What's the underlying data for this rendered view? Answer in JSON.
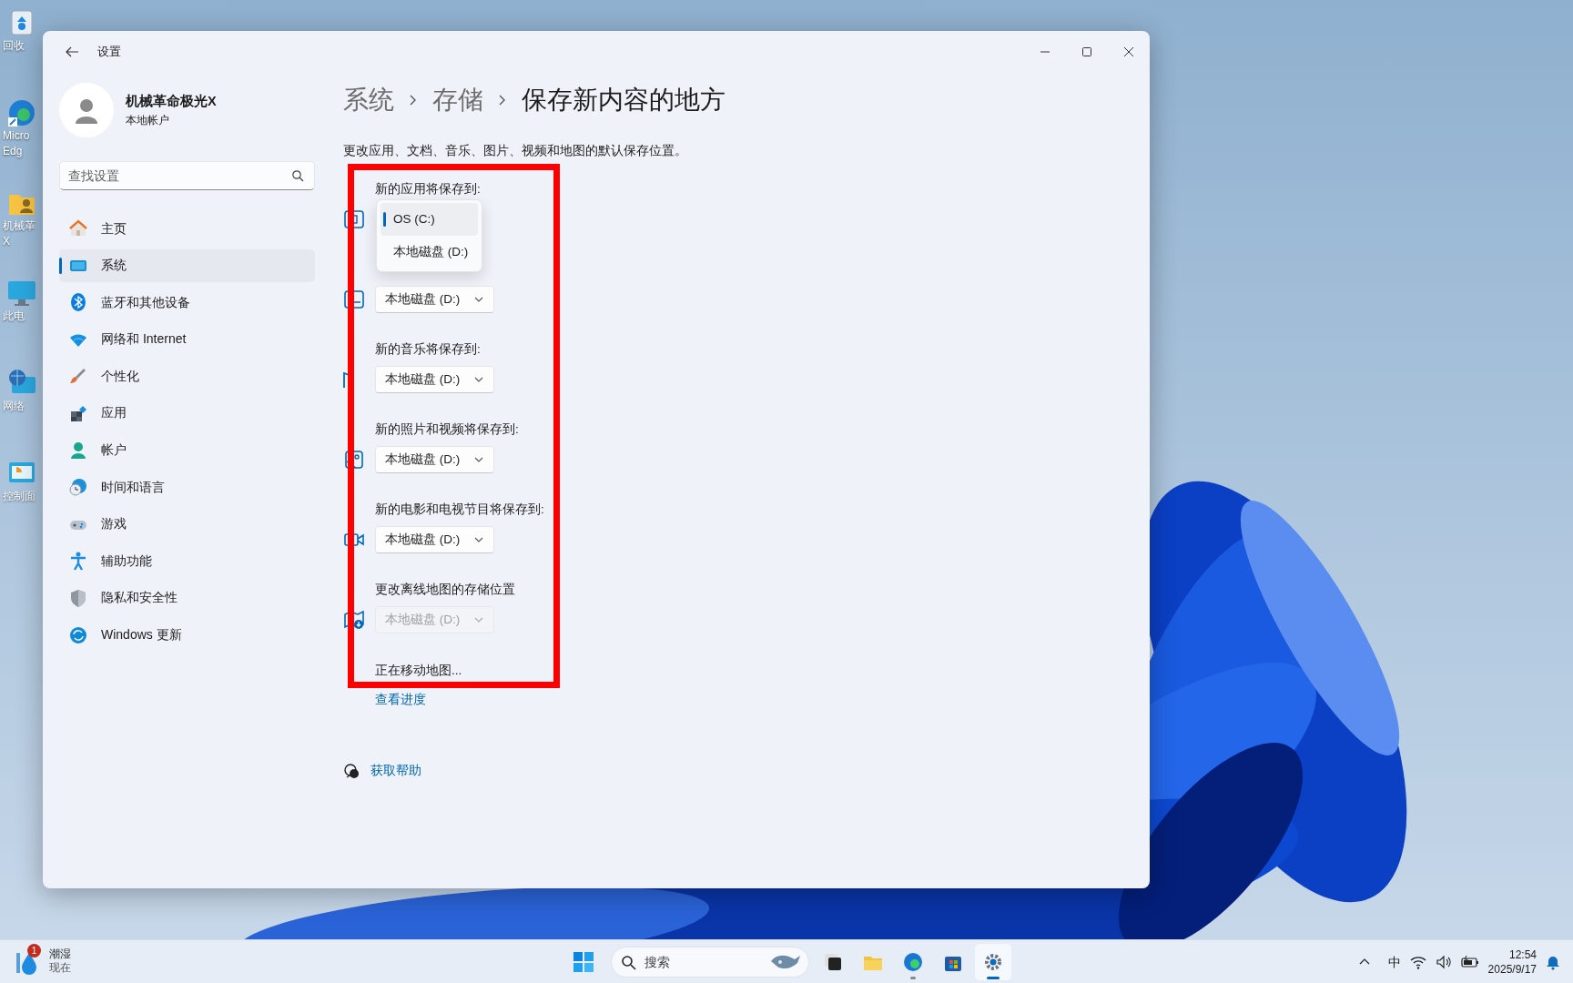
{
  "desktop": {
    "icons": [
      {
        "lines": [
          "回收"
        ]
      },
      {
        "lines": [
          "Micro",
          "Edg"
        ]
      },
      {
        "lines": [
          "机械革",
          "X"
        ]
      },
      {
        "lines": [
          "此电"
        ]
      },
      {
        "lines": [
          "网络"
        ]
      },
      {
        "lines": [
          "控制面"
        ]
      }
    ]
  },
  "window": {
    "title": "设置",
    "profile": {
      "name": "机械革命极光X",
      "account_type": "本地帐户"
    },
    "search": {
      "placeholder": "查找设置"
    },
    "sidebar": {
      "items": [
        {
          "label": "主页",
          "selected": false
        },
        {
          "label": "系统",
          "selected": true
        },
        {
          "label": "蓝牙和其他设备",
          "selected": false
        },
        {
          "label": "网络和 Internet",
          "selected": false
        },
        {
          "label": "个性化",
          "selected": false
        },
        {
          "label": "应用",
          "selected": false
        },
        {
          "label": "帐户",
          "selected": false
        },
        {
          "label": "时间和语言",
          "selected": false
        },
        {
          "label": "游戏",
          "selected": false
        },
        {
          "label": "辅助功能",
          "selected": false
        },
        {
          "label": "隐私和安全性",
          "selected": false
        },
        {
          "label": "Windows 更新",
          "selected": false
        }
      ]
    },
    "breadcrumb": [
      {
        "label": "系统",
        "current": false
      },
      {
        "label": "存储",
        "current": false
      },
      {
        "label": "保存新内容的地方",
        "current": true
      }
    ],
    "description": "更改应用、文档、音乐、图片、视频和地图的默认保存位置。",
    "settings": [
      {
        "label": "新的应用将保存到:",
        "expanded": true,
        "disabled": false,
        "options": [
          {
            "label": "OS (C:)",
            "selected": true
          },
          {
            "label": "本地磁盘 (D:)",
            "selected": false
          }
        ]
      },
      {
        "value": "本地磁盘 (D:)",
        "expanded": false,
        "disabled": false
      },
      {
        "label": "新的音乐将保存到:",
        "value": "本地磁盘 (D:)",
        "expanded": false,
        "disabled": false
      },
      {
        "label": "新的照片和视频将保存到:",
        "value": "本地磁盘 (D:)",
        "expanded": false,
        "disabled": false
      },
      {
        "label": "新的电影和电视节目将保存到:",
        "value": "本地磁盘 (D:)",
        "expanded": false,
        "disabled": false
      },
      {
        "label": "更改离线地图的存储位置",
        "value": "本地磁盘 (D:)",
        "expanded": false,
        "disabled": true
      }
    ],
    "status": "正在移动地图...",
    "progress_link": "查看进度",
    "help_link": "获取帮助"
  },
  "annotation_frame": true,
  "taskbar": {
    "weather": {
      "condition": "潮湿",
      "time": "现在",
      "badge": "1"
    },
    "search": {
      "placeholder": "搜索"
    },
    "apps": [
      {
        "selected": false,
        "running": false
      },
      {
        "selected": false,
        "running": false
      },
      {
        "selected": false,
        "running": true
      },
      {
        "selected": false,
        "running": false
      },
      {
        "selected": true,
        "running": true
      }
    ],
    "ime": "中",
    "time": "12:54",
    "date": "2025/9/17"
  }
}
